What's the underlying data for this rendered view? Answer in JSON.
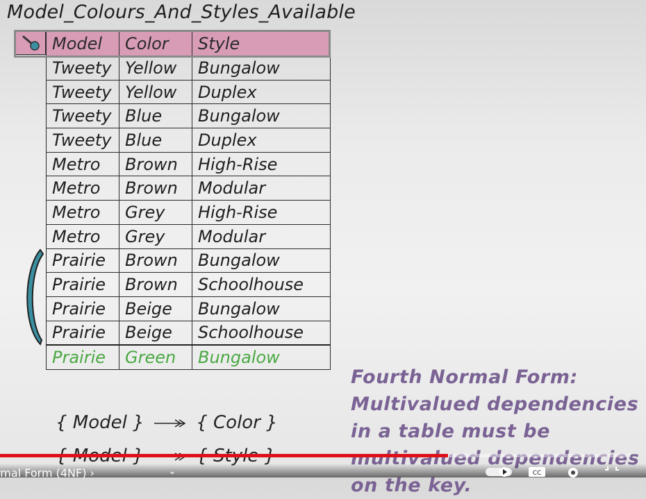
{
  "title": "Model_Colours_And_Styles_Available",
  "table": {
    "headers": [
      "Model",
      "Color",
      "Style"
    ],
    "rows": [
      [
        "Tweety",
        "Yellow",
        "Bungalow"
      ],
      [
        "Tweety",
        "Yellow",
        "Duplex"
      ],
      [
        "Tweety",
        "Blue",
        "Bungalow"
      ],
      [
        "Tweety",
        "Blue",
        "Duplex"
      ],
      [
        "Metro",
        "Brown",
        "High-Rise"
      ],
      [
        "Metro",
        "Brown",
        "Modular"
      ],
      [
        "Metro",
        "Grey",
        "High-Rise"
      ],
      [
        "Metro",
        "Grey",
        "Modular"
      ],
      [
        "Prairie",
        "Brown",
        "Bungalow"
      ],
      [
        "Prairie",
        "Brown",
        "Schoolhouse"
      ],
      [
        "Prairie",
        "Beige",
        "Bungalow"
      ],
      [
        "Prairie",
        "Beige",
        "Schoolhouse"
      ]
    ],
    "new_row": [
      "Prairie",
      "Green",
      "Bungalow"
    ]
  },
  "dependencies": [
    {
      "left": "{ Model }",
      "right": "{ Color }"
    },
    {
      "left": "{ Model }",
      "right": "{ Style }"
    }
  ],
  "note": "Fourth Normal Form: Multivalued dependencies in a table must be multivalued dependencies on the key.",
  "player": {
    "chapter": "rmal Form (4NF) ›",
    "progress_fraction": 0.71
  },
  "colors": {
    "header_bg": "#d89cb7",
    "new_row_text": "#4aa843",
    "note_text": "#7a6394",
    "bracket": "#3a8fa0",
    "progress": "#e0101a"
  },
  "icons": {
    "key": "key-icon",
    "settings": "gear-icon",
    "captions": "cc-icon",
    "play": "play-icon",
    "fullscreen": "exit-fullscreen-icon"
  }
}
